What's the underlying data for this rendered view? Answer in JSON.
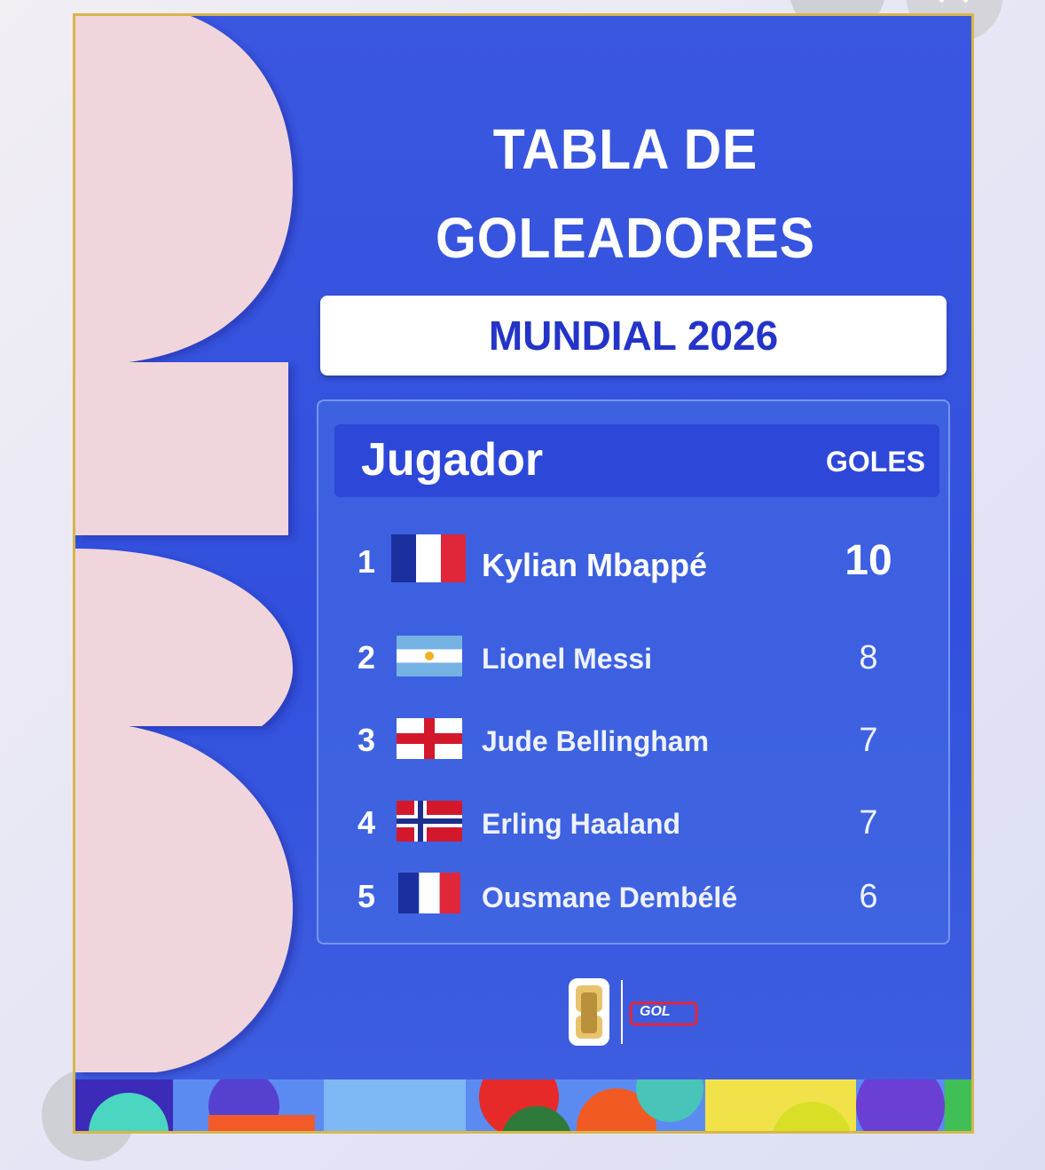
{
  "header": {
    "title_line1": "TABLA DE",
    "title_line2": "GOLEADORES",
    "subtitle": "MUNDIAL 2026"
  },
  "table": {
    "col_player": "Jugador",
    "col_goals": "GOLES",
    "rows": [
      {
        "rank": "1",
        "flag": "france-flag",
        "name": "Kylian Mbappé",
        "goals": "10"
      },
      {
        "rank": "2",
        "flag": "argentina-flag",
        "name": "Lionel Messi",
        "goals": "8"
      },
      {
        "rank": "3",
        "flag": "england-flag",
        "name": "Jude Bellingham",
        "goals": "7"
      },
      {
        "rank": "4",
        "flag": "norway-flag",
        "name": "Erling Haaland",
        "goals": "7"
      },
      {
        "rank": "5",
        "flag": "france-flag",
        "name": "Ousmane Dembélé",
        "goals": "6"
      }
    ]
  },
  "logos": {
    "brand": "GOL"
  },
  "colors": {
    "card_blue": "#3150dd",
    "subtitle_text": "#2434c8",
    "accent_pink": "#f0d6dc",
    "frame_gold": "#d7b64a"
  }
}
